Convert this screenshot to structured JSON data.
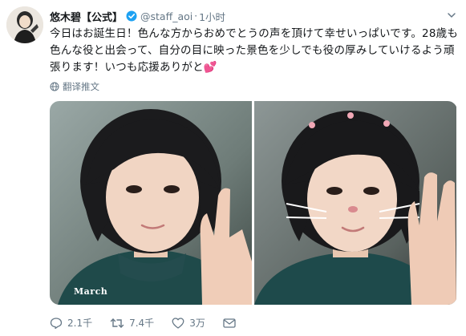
{
  "tweet": {
    "display_name": "悠木碧【公式】",
    "handle": "@staff_aoi",
    "separator": "·",
    "time": "1小时",
    "text": "今日はお誕生日！色んな方からおめでとうの声を頂けて幸せいっぱいです。28歳も色んな役と出会って、自分の目に映った景色を少しでも役の厚みしていけるよう頑張ります！いつも応援ありがと",
    "emoji": "💕",
    "translate_label": "翻译推文",
    "photo_caption": "March",
    "stats": {
      "replies": "2.1千",
      "retweets": "7.4千",
      "likes": "3万"
    }
  },
  "icons": {
    "verified": "verified-badge-icon",
    "caret": "chevron-down-icon",
    "translate": "globe-icon",
    "reply": "reply-icon",
    "retweet": "retweet-icon",
    "like": "heart-icon",
    "dm": "envelope-icon"
  },
  "colors": {
    "verified": "#1da1f2",
    "text": "#14171a",
    "muted": "#657786",
    "heart_emoji": "#e0245e"
  }
}
